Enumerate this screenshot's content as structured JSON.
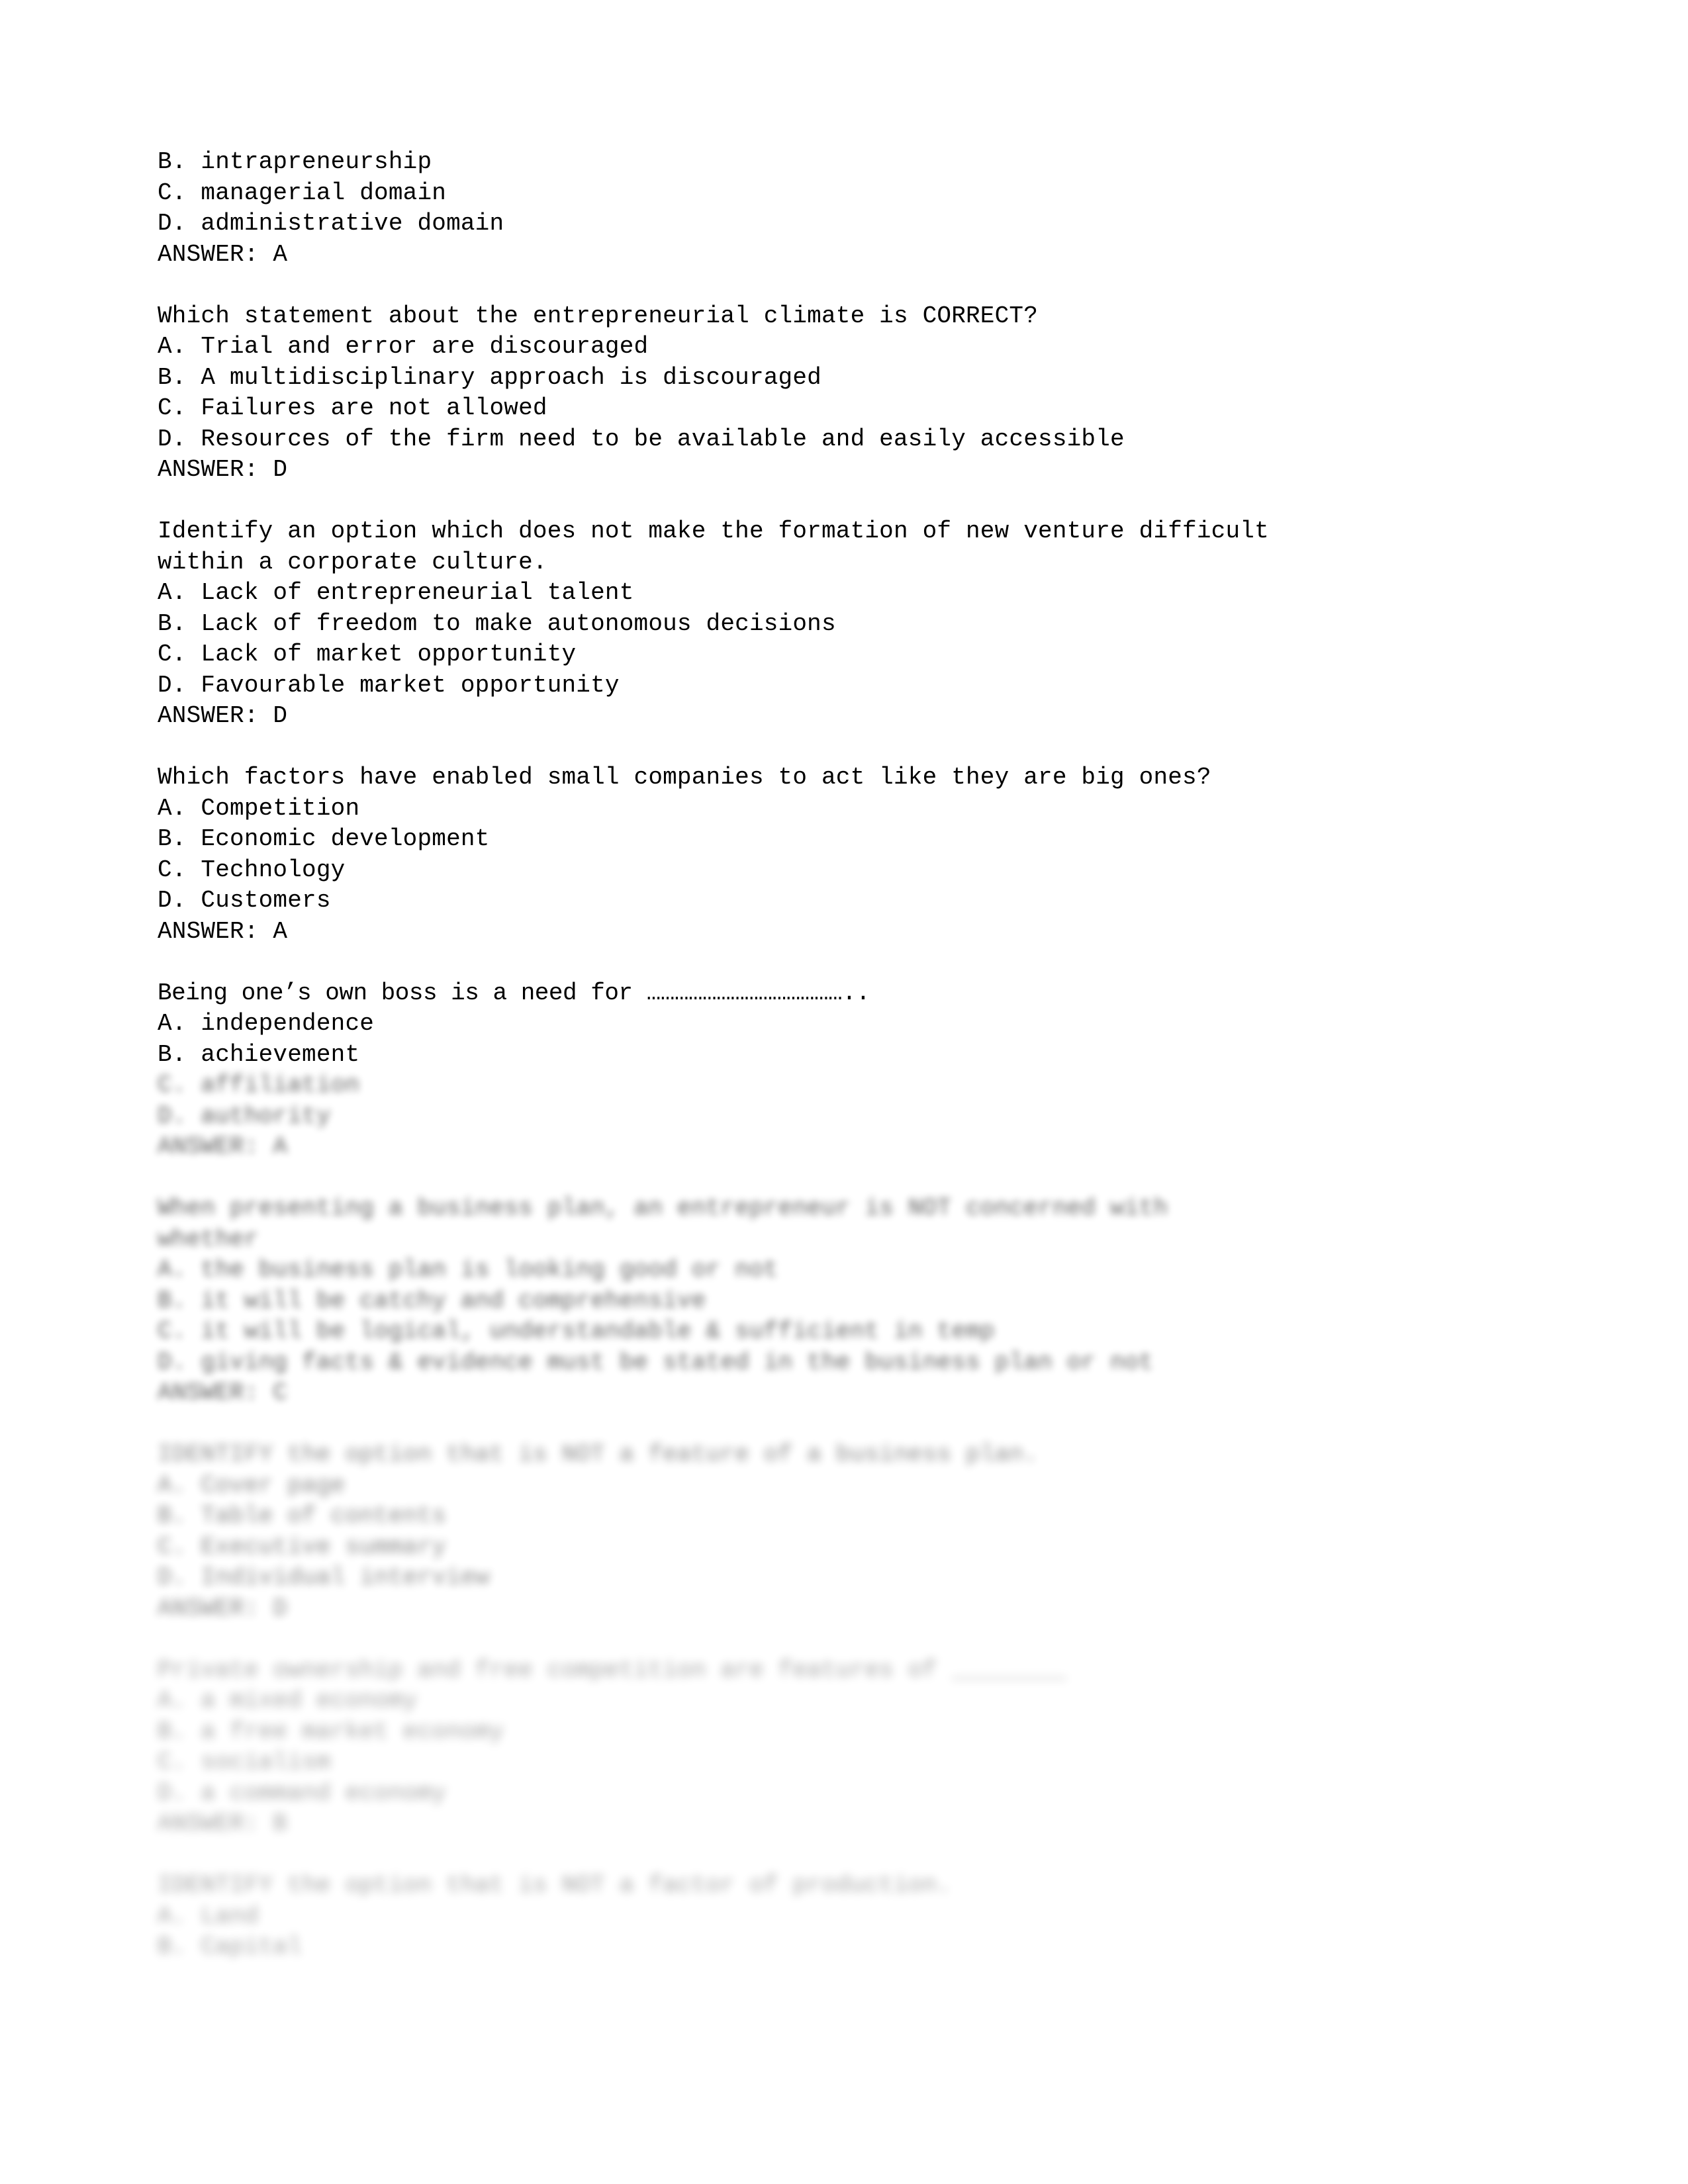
{
  "document": {
    "type": "exam-question-bank",
    "page_background": "#ffffff",
    "text_color": "#000000"
  },
  "sharp_blocks": [
    {
      "id": "block-1-tail",
      "lines": [
        "B. intrapreneurship",
        "C. managerial domain",
        "D. administrative domain",
        "ANSWER: A"
      ]
    },
    {
      "id": "block-2",
      "lines": [
        "Which statement about the entrepreneurial climate is CORRECT?",
        "A. Trial and error are discouraged",
        "B. A multidisciplinary approach is discouraged",
        "C. Failures are not allowed",
        "D. Resources of the firm need to be available and easily accessible",
        "ANSWER: D"
      ]
    },
    {
      "id": "block-3",
      "lines": [
        "Identify an option which does not make the formation of new venture difficult",
        "within a corporate culture.",
        "A. Lack of entrepreneurial talent",
        "B. Lack of freedom to make autonomous decisions",
        "C. Lack of market opportunity",
        "D. Favourable market opportunity",
        "ANSWER: D"
      ]
    },
    {
      "id": "block-4",
      "lines": [
        "Which factors have enabled small companies to act like they are big ones?",
        "A. Competition",
        "B. Economic development",
        "C. Technology",
        "D. Customers",
        "ANSWER: A"
      ]
    },
    {
      "id": "block-5-head",
      "lines": [
        "Being one’s own boss is a need for ……………………………………..",
        "A. independence",
        "B. achievement"
      ]
    }
  ],
  "blurred_blocks": [
    {
      "id": "block-5-tail",
      "intensity": "light",
      "lines": [
        "C. affiliation",
        "D. authority",
        "ANSWER: A"
      ]
    },
    {
      "id": "block-6",
      "intensity": "light",
      "lines": [
        "When presenting a business plan, an entrepreneur is NOT concerned with",
        "whether",
        "A. the business plan is looking good or not",
        "B. it will be catchy and comprehensive",
        "C. it will be logical, understandable & sufficient in temp",
        "D. giving facts & evidence must be stated in the business plan or not",
        "ANSWER: C"
      ]
    },
    {
      "id": "block-7",
      "intensity": "medium",
      "lines": [
        "IDENTIFY the option that is NOT a feature of a business plan.",
        "A. Cover page",
        "B. Table of contents",
        "C. Executive summary",
        "D. Individual interview",
        "ANSWER: D"
      ]
    },
    {
      "id": "block-8",
      "intensity": "deep",
      "lines": [
        "Private ownership and free competition are features of ________",
        "A. a mixed economy",
        "B. a free market economy",
        "C. socialism",
        "D. a command economy",
        "ANSWER: B"
      ]
    },
    {
      "id": "block-9",
      "intensity": "deep",
      "lines": [
        "IDENTIFY the option that is NOT a factor of production.",
        "A. Land",
        "B. Capital"
      ]
    }
  ]
}
